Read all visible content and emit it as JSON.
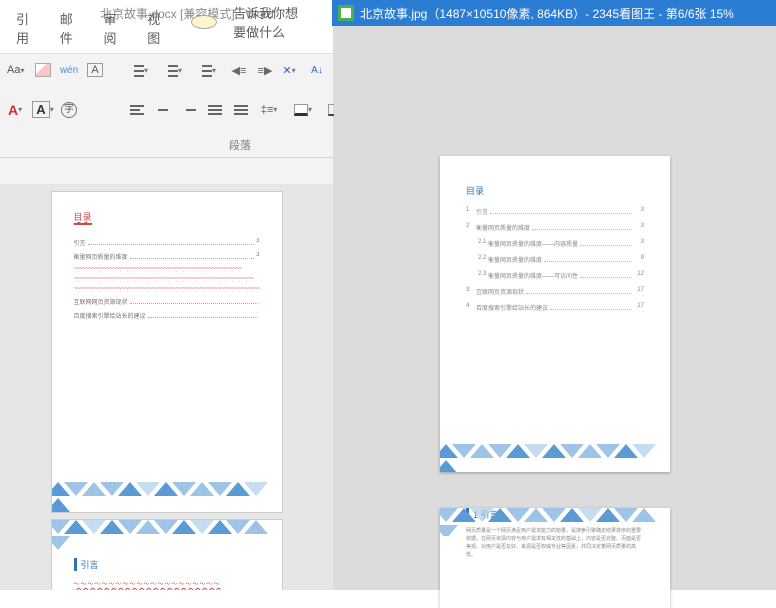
{
  "titlebar": {
    "word": "北京故事.docx [兼容模式] - Word",
    "viewer": "北京故事.jpg（1487×10510像素, 864KB）- 2345看图王 - 第6/6张 15%"
  },
  "ribbon": {
    "tabs": {
      "references": "引用",
      "mailings": "邮件",
      "review": "审阅",
      "view": "视图",
      "tellme": "告诉我你想要做什么"
    },
    "groups": {
      "paragraph_label": "段落"
    }
  },
  "left_doc": {
    "toc_heading": "目录",
    "items": [
      {
        "text": "引言",
        "page": "3"
      },
      {
        "text": "衡量网页质量的维度",
        "page": "3"
      },
      {
        "text": "",
        "page": ""
      },
      {
        "text": "",
        "page": ""
      },
      {
        "text": "",
        "page": ""
      },
      {
        "text": "互联网网页资源现状",
        "page": ""
      },
      {
        "text": "百度搜索引擎给站长的建议",
        "page": ""
      }
    ],
    "section_heading": "引言"
  },
  "right_doc": {
    "toc_heading": "目录",
    "items": [
      {
        "num": "1",
        "text": "引言",
        "page": "3",
        "lvl": 0
      },
      {
        "num": "2",
        "text": "衡量网页质量的维度",
        "page": "3",
        "lvl": 0
      },
      {
        "num": "2.1",
        "text": "衡量网页质量的维度——内容质量",
        "page": "3",
        "lvl": 1
      },
      {
        "num": "2.2",
        "text": "衡量网页质量的维度",
        "page": "9",
        "lvl": 1
      },
      {
        "num": "2.3",
        "text": "衡量网页质量的维度——可访问性",
        "page": "12",
        "lvl": 1
      },
      {
        "num": "3",
        "text": "互联网页资源现状",
        "page": "17",
        "lvl": 0
      },
      {
        "num": "4",
        "text": "百度搜索引擎给站长的建议",
        "page": "17",
        "lvl": 0
      }
    ],
    "section_heading": "1 引言",
    "body": "网页质量是一个网页满足用户需求能力的衡量，是搜索引擎确定结果排序的重要依据。在网页资源内容与用户需求有相关性的基础上，内容是否完整、页面是否美观、对用户是否友好、来源是否权威专业等因素，共同决定着网页质量的高低。"
  }
}
